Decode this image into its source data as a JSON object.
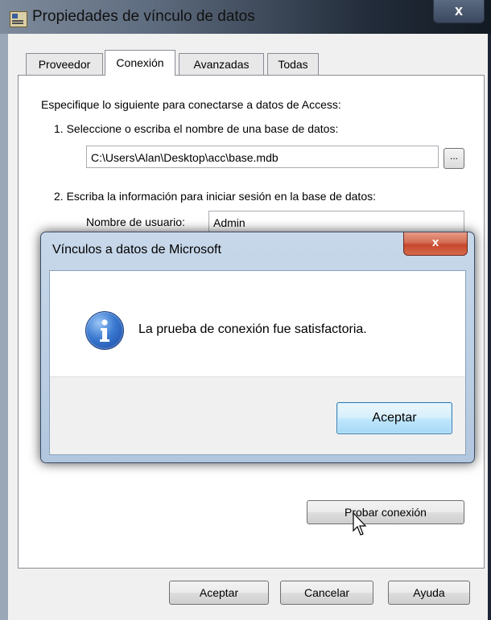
{
  "window": {
    "title": "Propiedades de vínculo de datos",
    "close_glyph": "x"
  },
  "tabs": [
    {
      "label": "Proveedor"
    },
    {
      "label": "Conexión"
    },
    {
      "label": "Avanzadas"
    },
    {
      "label": "Todas"
    }
  ],
  "connection": {
    "intro": "Especifique lo siguiente para conectarse a datos de Access:",
    "step1_label": "1. Seleccione o escriba el nombre de una base de datos:",
    "db_path": "C:\\Users\\Alan\\Desktop\\acc\\base.mdb",
    "browse_label": "...",
    "step2_label": "2. Escriba la información para iniciar sesión en la base de datos:",
    "username_label": "Nombre de usuario:",
    "username_value": "Admin",
    "test_button": "Probar conexión"
  },
  "footer_buttons": {
    "ok": "Aceptar",
    "cancel": "Cancelar",
    "help": "Ayuda"
  },
  "message_dialog": {
    "title": "Vínculos a datos de Microsoft",
    "close_glyph": "x",
    "icon": "info-icon",
    "message": "La prueba de conexión fue satisfactoria.",
    "ok_button": "Aceptar"
  },
  "colors": {
    "accent_button": "#bee6fd",
    "dialog_frame": "#b2c7de",
    "close_red": "#c7472c"
  }
}
